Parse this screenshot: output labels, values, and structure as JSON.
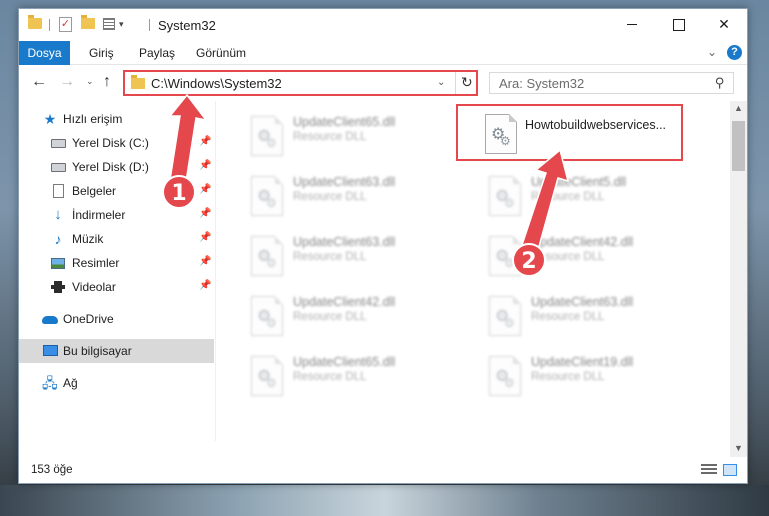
{
  "titlebar": {
    "title": "System32",
    "minimize": "—",
    "maximize": "",
    "close": "✕"
  },
  "ribbon": {
    "tabs": [
      "Dosya",
      "Giriş",
      "Paylaş",
      "Görünüm"
    ],
    "help": "?"
  },
  "nav": {
    "path": "C:\\Windows\\System32",
    "search_placeholder": "Ara: System32"
  },
  "sidebar": {
    "items": [
      {
        "label": "Hızlı erişim",
        "icon": "quick-access-star-icon"
      },
      {
        "label": "Yerel Disk (C:)",
        "icon": "drive-icon",
        "pinned": true
      },
      {
        "label": "Yerel Disk (D:)",
        "icon": "drive-icon",
        "pinned": true
      },
      {
        "label": "Belgeler",
        "icon": "documents-icon",
        "pinned": true
      },
      {
        "label": "İndirmeler",
        "icon": "downloads-icon",
        "pinned": true
      },
      {
        "label": "Müzik",
        "icon": "music-icon",
        "pinned": true
      },
      {
        "label": "Resimler",
        "icon": "pictures-icon",
        "pinned": true
      },
      {
        "label": "Videolar",
        "icon": "videos-icon",
        "pinned": true
      },
      {
        "label": "OneDrive",
        "icon": "onedrive-icon"
      },
      {
        "label": "Bu bilgisayar",
        "icon": "this-pc-icon",
        "selected": true
      },
      {
        "label": "Ağ",
        "icon": "network-icon"
      }
    ]
  },
  "files": [
    {
      "name": "UpdateClient65.dll",
      "type": "Resource DLL"
    },
    {
      "name": "Howtobuildwebservices...",
      "type": ""
    },
    {
      "name": "UpdateClient63.dll",
      "type": "Resource DLL"
    },
    {
      "name": "UpdateClient5.dll",
      "type": "Resource DLL"
    },
    {
      "name": "UpdateClient63.dll",
      "type": "Resource DLL"
    },
    {
      "name": "UpdateClient42.dll",
      "type": "Resource DLL"
    },
    {
      "name": "UpdateClient42.dll",
      "type": "Resource DLL"
    },
    {
      "name": "UpdateClient63.dll",
      "type": "Resource DLL"
    },
    {
      "name": "UpdateClient65.dll",
      "type": "Resource DLL"
    },
    {
      "name": "UpdateClient19.dll",
      "type": "Resource DLL"
    }
  ],
  "status": {
    "item_count": "153 öğe"
  },
  "annotations": {
    "badge_1": "1",
    "badge_2": "2",
    "color": "#e4474c"
  },
  "colors": {
    "accent": "#1979ca",
    "highlight": "#e4474c"
  }
}
